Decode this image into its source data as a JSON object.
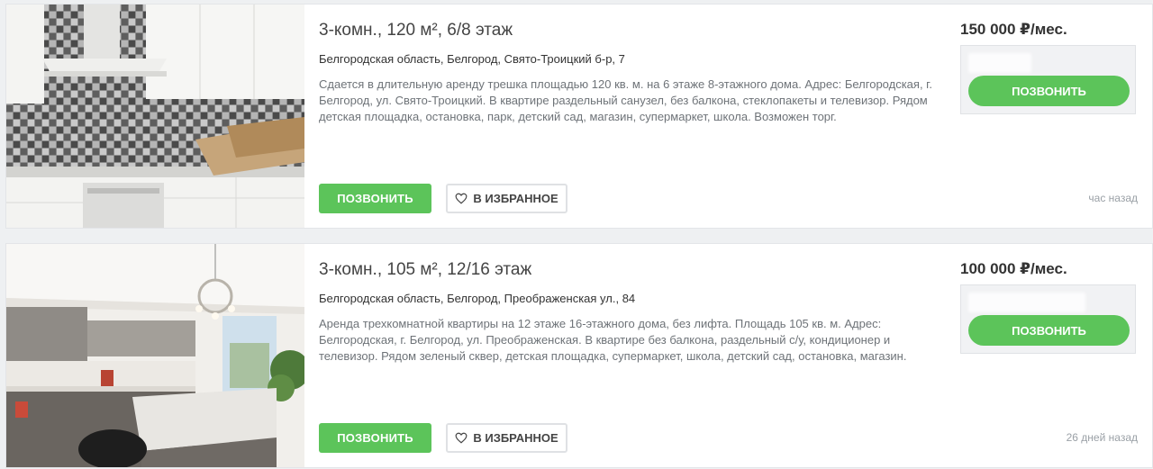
{
  "listings": [
    {
      "title": "3-комн., 120 м², 6/8 этаж",
      "address": "Белгородская область, Белгород, Свято-Троицкий б-р, 7",
      "description": "Сдается в длительную аренду трешка площадью 120 кв. м. на 6 этаже 8-этажного дома. Адрес: Белгородская, г. Белгород, ул. Свято-Троицкий. В квартире раздельный санузел, без балкона, стеклопакеты и телевизор. Рядом детская площадка, остановка, парк, детский сад, магазин, супермаркет, школа. Возможен торг.",
      "price": "150 000 ₽/мес.",
      "call_label": "ПОЗВОНИТЬ",
      "side_call_label": "ПОЗВОНИТЬ",
      "fav_label": "В ИЗБРАННОЕ",
      "time": "час назад"
    },
    {
      "title": "3-комн., 105 м², 12/16 этаж",
      "address": "Белгородская область, Белгород, Преображенская ул., 84",
      "description": "Аренда трехкомнатной квартиры на 12 этаже 16-этажного дома, без лифта. Площадь 105 кв. м. Адрес: Белгородская, г. Белгород, ул. Преображенская. В квартире без балкона, раздельный с/у, кондиционер и телевизор. Рядом зеленый сквер, детская площадка, супермаркет, школа, детский сад, остановка, магазин.",
      "price": "100 000 ₽/мес.",
      "call_label": "ПОЗВОНИТЬ",
      "side_call_label": "ПОЗВОНИТЬ",
      "fav_label": "В ИЗБРАННОЕ",
      "time": "26 дней назад"
    }
  ],
  "icons": {
    "favorite": "heart-outline-icon"
  },
  "colors": {
    "accent_green": "#5cc45a",
    "muted_text": "#6e7378",
    "time_text": "#9aa0a6"
  }
}
